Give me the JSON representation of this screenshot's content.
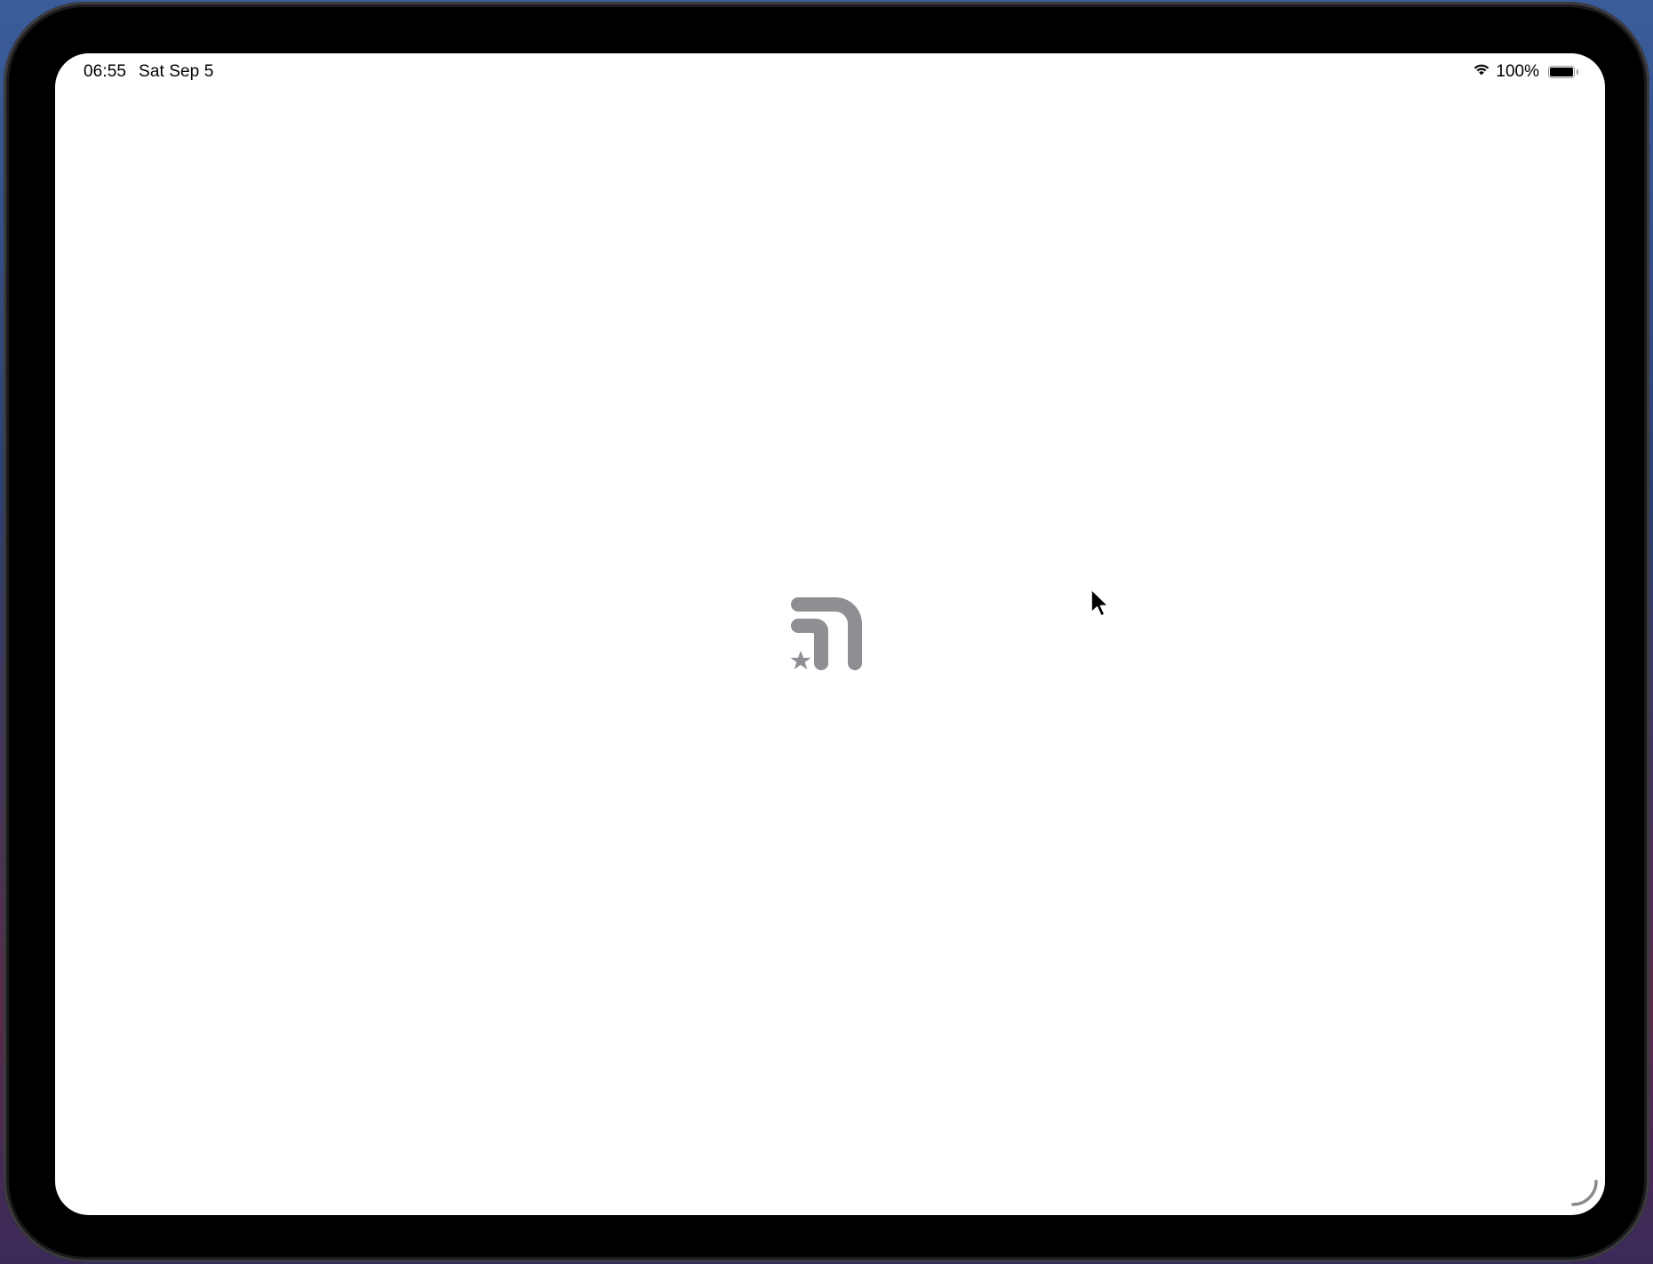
{
  "status_bar": {
    "time": "06:55",
    "date": "Sat Sep 5",
    "battery_percent": "100%",
    "battery_level": 1.0,
    "wifi_icon": "wifi-icon",
    "battery_icon": "battery-icon"
  },
  "splash": {
    "logo_icon": "app-logo-icon",
    "logo_color": "#8e8e93"
  },
  "cursor_icon": "pointer-cursor-icon",
  "colors": {
    "screen_background": "#ffffff",
    "bezel": "#000000"
  }
}
